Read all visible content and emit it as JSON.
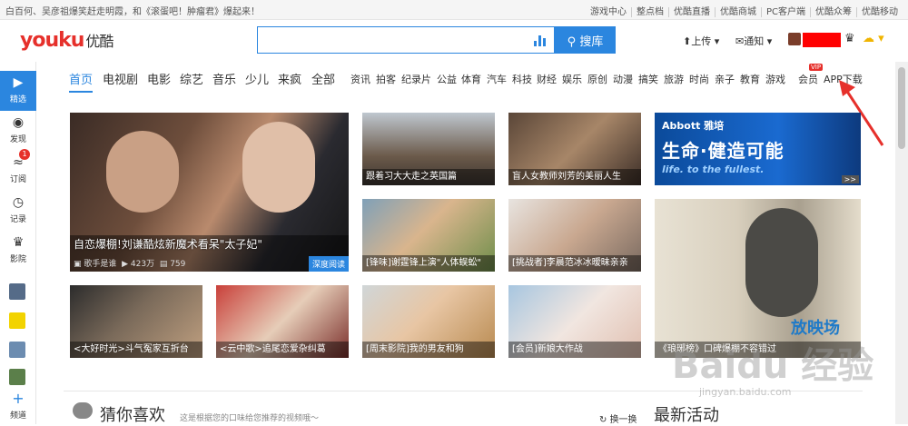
{
  "topbar": {
    "news": "白百何、吴彦祖爆笑赶走明霞，和《滚蛋吧！肿瘤君》爆起来！",
    "links": [
      "游戏中心",
      "整点档",
      "优酷直播",
      "优酷商城",
      "PC客户端",
      "优酷众筹",
      "优酷移动"
    ]
  },
  "header": {
    "logo_latin": "youku",
    "logo_cn": "优酷",
    "search_placeholder": "",
    "search_button": "搜库",
    "upload": "上传",
    "notify": "通知"
  },
  "sidebar": {
    "items": [
      {
        "label": "精选",
        "icon": "play-icon"
      },
      {
        "label": "发现",
        "icon": "eye-icon"
      },
      {
        "label": "订阅",
        "icon": "rss-icon",
        "badge": "1"
      },
      {
        "label": "记录",
        "icon": "clock-icon"
      },
      {
        "label": "影院",
        "icon": "crown-icon"
      }
    ],
    "bottom": "频道"
  },
  "nav": {
    "big": [
      "首页",
      "电视剧",
      "电影",
      "综艺",
      "音乐",
      "少儿",
      "来疯",
      "全部"
    ],
    "small": [
      "资讯",
      "拍客",
      "纪录片",
      "公益",
      "体育",
      "汽车",
      "科技",
      "财经",
      "娱乐",
      "原创",
      "动漫",
      "搞笑",
      "旅游",
      "时尚",
      "亲子",
      "教育",
      "游戏"
    ],
    "member": "会员",
    "vip": "VIP",
    "app": "APP下载"
  },
  "tiles": {
    "hero": {
      "title": "自恋爆棚!刘谦酷炫新魔术看呆\"太子妃\"",
      "owner": "歌手是谁",
      "views": "423万",
      "comments": "759",
      "tag": "深度阅读"
    },
    "t1": "跟着习大大走之英国篇",
    "t2": "盲人女教师刘芳的美丽人生",
    "ad": {
      "brand": "Abbott 雅培",
      "slogan": "生命·健造可能",
      "sub": "life. to the fullest.",
      "arrows": ">>"
    },
    "t3": "[锋味]谢霆锋上演\"人体蜈蚣\"",
    "t4": "[挑战者]李晨范冰冰暧昧亲亲",
    "t5": "<大好时光>斗气冤家互折台",
    "t6": "<云中歌>追尾恋爱杂纠葛",
    "t7": "[周末影院]我的男友和狗",
    "t8": "[会员]新娘大作战",
    "t9": "《琅琊榜》口碑爆棚不容错过",
    "t9_brand": "放映场"
  },
  "bottom": {
    "left_title": "猜你喜欢",
    "desc": "这是根据您的口味给您推荐的视频哦～",
    "switch": "换一换",
    "right_title": "最新活动"
  },
  "watermark": {
    "main": "Baidu 经验",
    "sub": "jingyan.baidu.com"
  }
}
